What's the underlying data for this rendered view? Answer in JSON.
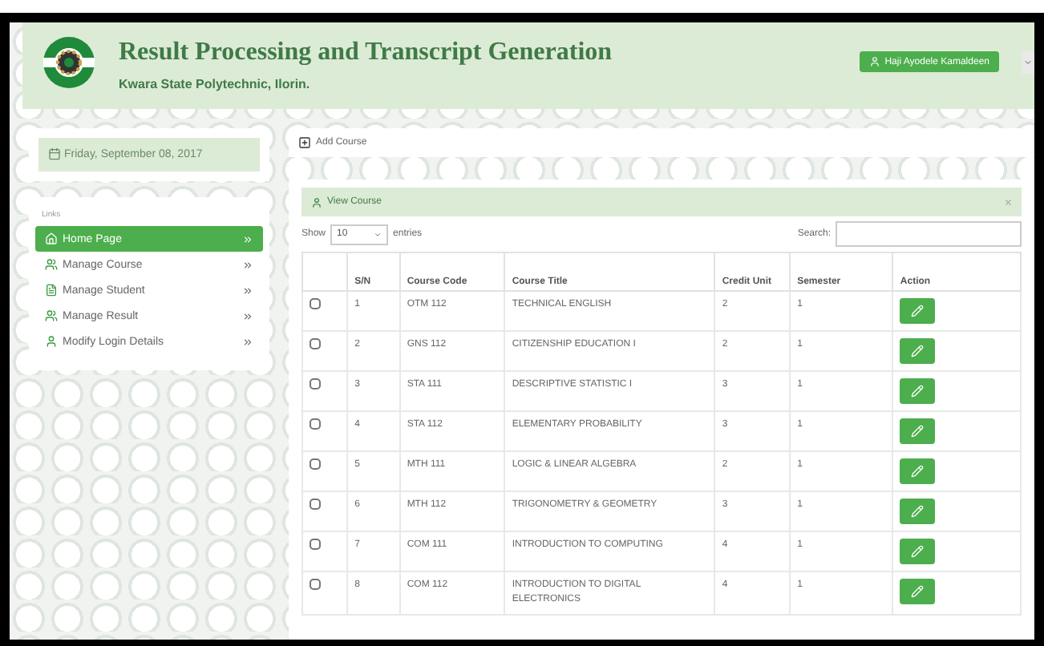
{
  "header": {
    "title": "Result Processing and Transcript Generation",
    "subtitle": "Kwara State Polytechnic, Ilorin.",
    "user_button": "Haji Ayodele Kamaldeen"
  },
  "date": "Friday, September 08, 2017",
  "sidebar": {
    "heading": "Links",
    "items": [
      {
        "label": "Home Page",
        "selected": true
      },
      {
        "label": "Manage Course",
        "selected": false
      },
      {
        "label": "Manage Student",
        "selected": false
      },
      {
        "label": "Manage Result",
        "selected": false
      },
      {
        "label": "Modify Login Details",
        "selected": false
      }
    ]
  },
  "toolbar": {
    "add_button": "Add Course"
  },
  "panel": {
    "title": "View Course",
    "close": "×"
  },
  "table_controls": {
    "show_label": "Show",
    "page_size": "10",
    "entries_label": "entries",
    "search_label": "Search:"
  },
  "table": {
    "columns": [
      "S/N",
      "Course Code",
      "Course Title",
      "Credit Unit",
      "Semester",
      "Action"
    ],
    "rows": [
      {
        "checked": false,
        "cells": [
          "1",
          "OTM 112",
          "TECHNICAL ENGLISH",
          "2",
          "1"
        ]
      },
      {
        "checked": false,
        "cells": [
          "2",
          "GNS 112",
          "CITIZENSHIP EDUCATION I",
          "2",
          "1"
        ]
      },
      {
        "checked": false,
        "cells": [
          "3",
          "STA 111",
          "DESCRIPTIVE STATISTIC I",
          "3",
          "1"
        ]
      },
      {
        "checked": false,
        "cells": [
          "4",
          "STA 112",
          "ELEMENTARY PROBABILITY",
          "3",
          "1"
        ]
      },
      {
        "checked": false,
        "cells": [
          "5",
          "MTH 111",
          "LOGIC & LINEAR ALGEBRA",
          "2",
          "1"
        ]
      },
      {
        "checked": false,
        "cells": [
          "6",
          "MTH 112",
          "TRIGONOMETRY & GEOMETRY",
          "3",
          "1"
        ]
      },
      {
        "checked": false,
        "cells": [
          "7",
          "COM 111",
          "INTRODUCTION TO COMPUTING",
          "4",
          "1"
        ]
      },
      {
        "checked": false,
        "cells": [
          "8",
          "COM 112",
          "INTRODUCTION TO DIGITAL ELECTRONICS",
          "4",
          "1"
        ]
      }
    ]
  }
}
